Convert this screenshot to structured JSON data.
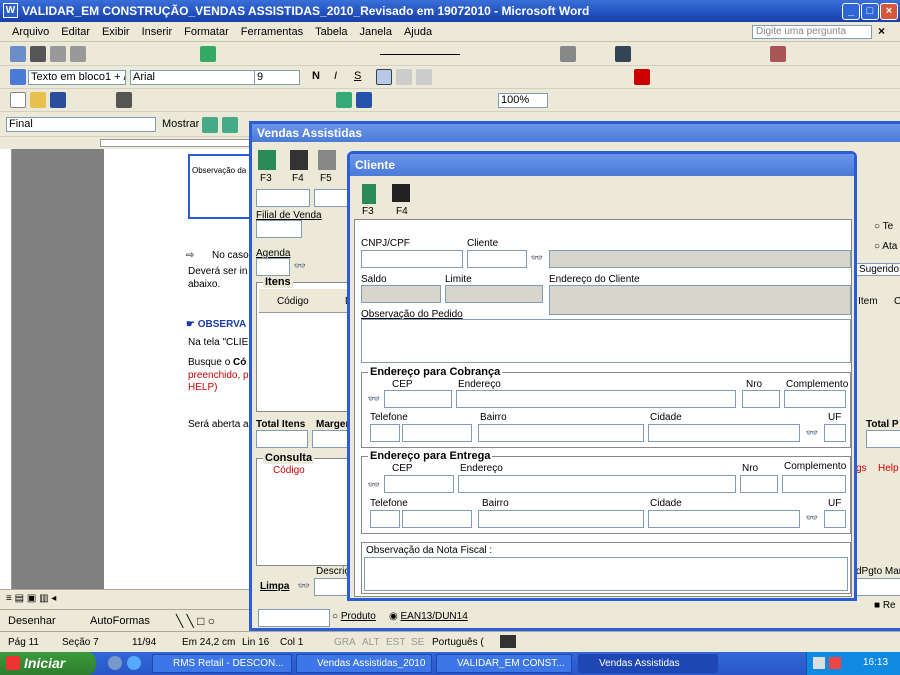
{
  "word": {
    "title": "VALIDAR_EM CONSTRUÇÃO_VENDAS ASSISTIDAS_2010_Revisado em 19072010 - Microsoft Word",
    "menu": [
      "Arquivo",
      "Editar",
      "Exibir",
      "Inserir",
      "Formatar",
      "Ferramentas",
      "Tabela",
      "Janela",
      "Ajuda"
    ],
    "help_placeholder": "Digite uma pergunta",
    "style_box": "Texto em bloco1 + /",
    "font_box": "Arial",
    "size_box": "9",
    "zoom": "100%",
    "view_mode": "Final",
    "show_label": "Mostrar",
    "draw_label": "Desenhar",
    "autoforms_label": "AutoFormas",
    "doc_text": {
      "no_caso": "No caso",
      "devera": "Deverá ser in",
      "abaixo": "abaixo.",
      "obs": "OBSERVA",
      "na_tela": "Na tela \"CLIE",
      "busque": "Busque o",
      "busque_bold": "Có",
      "preenchido": "preenchido, p",
      "help": "HELP)",
      "sera": "Será aberta a",
      "obs_box": "Observação da"
    },
    "status": {
      "page": "Pág 11",
      "section": "Seção 7",
      "pages": "11/94",
      "pos": "Em 24,2 cm",
      "line": "Lin 16",
      "col": "Col 1",
      "grv": "GRA",
      "alt": "ALT",
      "est": "EST",
      "se": "SE",
      "lang": "Português ("
    }
  },
  "vendas": {
    "title": "Vendas Assistidas",
    "keys": [
      "F3",
      "F4",
      "F5"
    ],
    "filial_label": "Filial de Venda",
    "agenda_label": "Agenda",
    "itens_label": "Itens",
    "codigo_col": "Código",
    "de_col": "De",
    "total_itens": "Total Itens",
    "margem": "Margen",
    "consulta": "Consulta",
    "consulta_codigo": "Código",
    "descricao": "Descriçã",
    "limpa": "Limpa",
    "produto": "Produto",
    "ean": "EAN13/DUN14",
    "right_opt1": "Te",
    "right_opt2": "Ata",
    "sugerido": "Sugerido",
    "item_col": "r Item",
    "c_col": "C",
    "total_p": "Total P",
    "gs": "gs",
    "help": "Help",
    "pgto": "dPgto Marg",
    "re": "Re"
  },
  "cliente": {
    "title": "Cliente",
    "keys": [
      "F3",
      "F4"
    ],
    "cnpj_label": "CNPJ/CPF",
    "cliente_label": "Cliente",
    "saldo_label": "Saldo",
    "limite_label": "Limite",
    "endereco_cliente_label": "Endereço do Cliente",
    "obs_pedido_label": "Observação do Pedido",
    "cobranca": {
      "title": "Endereço para Cobrança",
      "cep": "CEP",
      "endereco": "Endereço",
      "nro": "Nro",
      "complemento": "Complemento",
      "telefone": "Telefone",
      "bairro": "Bairro",
      "cidade": "Cidade",
      "uf": "UF"
    },
    "entrega": {
      "title": "Endereço para Entrega",
      "cep": "CEP",
      "endereco": "Endereço",
      "nro": "Nro",
      "complemento": "Complemento",
      "telefone": "Telefone",
      "bairro": "Bairro",
      "cidade": "Cidade",
      "uf": "UF"
    },
    "obs_nf_label": "Observação da Nota Fiscal :"
  },
  "taskbar": {
    "start": "Iniciar",
    "tasks": [
      "RMS Retail - DESCON...",
      "Vendas Assistidas_2010",
      "VALIDAR_EM CONST...",
      "Vendas Assistidas"
    ],
    "clock": "16:13"
  },
  "colors": {
    "xp_blue": "#2a5dd6",
    "start_green": "#3c9a3c",
    "red_text": "#cc0000"
  }
}
